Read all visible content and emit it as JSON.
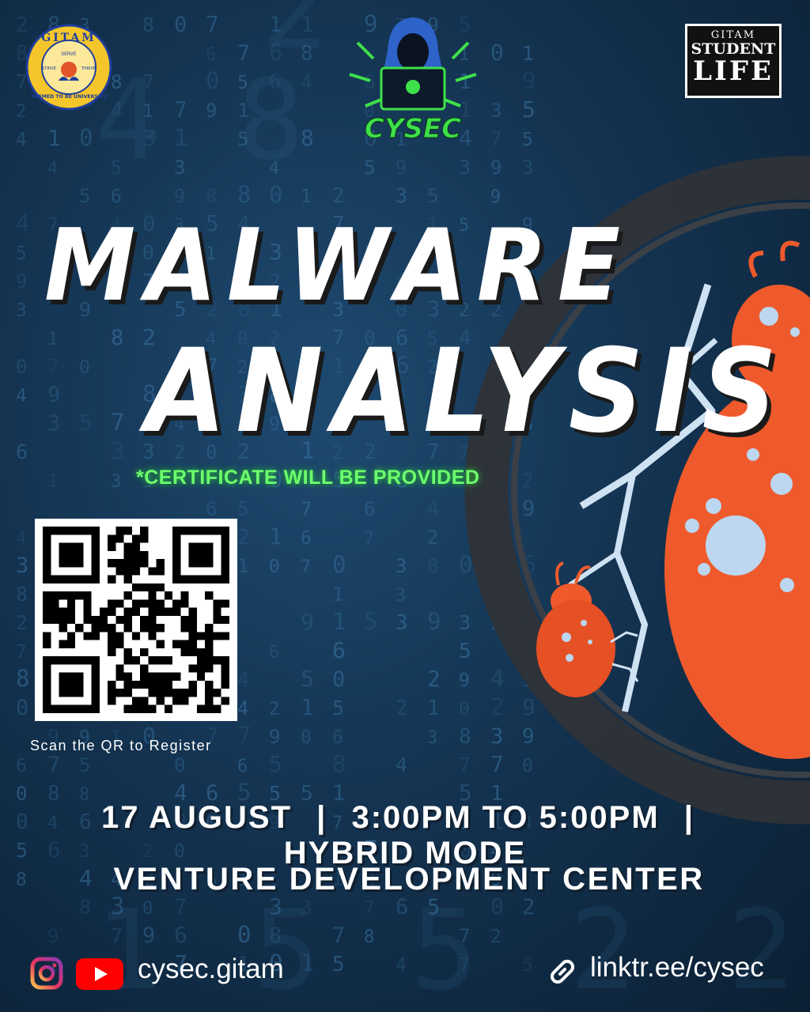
{
  "logos": {
    "gitam": {
      "top_text": "GITAM",
      "motto_left": "STRIVE",
      "motto_center": "SERVE",
      "motto_right": "THRIVE",
      "bottom_text": "DEEMED TO BE UNIVERSITY"
    },
    "cysec": {
      "text": "CYSEC"
    },
    "student_life": {
      "line1": "GITAM",
      "line2": "STUDENT",
      "line3": "LIFE"
    }
  },
  "title": {
    "line1": "MALWARE",
    "line2": "ANALYSIS"
  },
  "certificate_note": "*CERTIFICATE WILL BE PROVIDED",
  "qr": {
    "caption": "Scan the QR to Register"
  },
  "event": {
    "date": "17 AUGUST",
    "separator": "|",
    "time": "3:00PM TO 5:00PM",
    "mode": "HYBRID MODE",
    "venue": "VENTURE DEVELOPMENT CENTER"
  },
  "footer": {
    "social_handle": "cysec.gitam",
    "link": "linktr.ee/cysec",
    "icons": [
      "instagram-icon",
      "youtube-icon",
      "link-icon"
    ]
  },
  "colors": {
    "background": "#143452",
    "title": "#ffffff",
    "certificate": "#6dff6d",
    "bug": "#ef5a2c",
    "cysec_green": "#3ee04a"
  }
}
